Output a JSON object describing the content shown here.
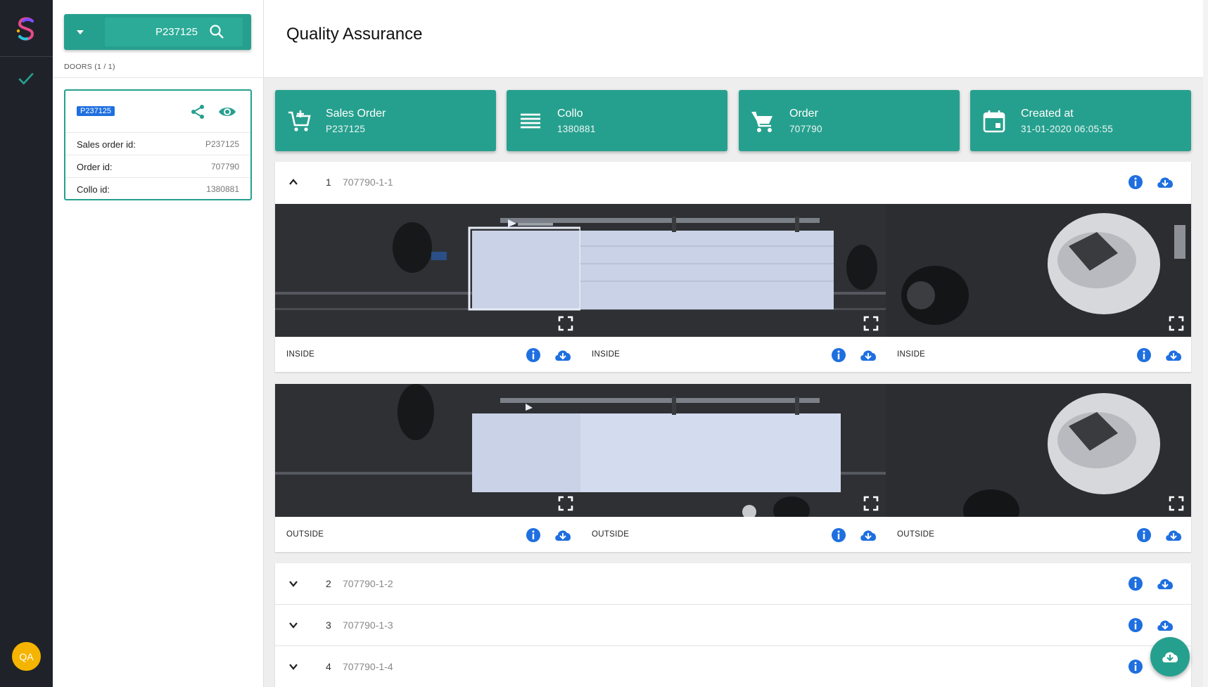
{
  "app": {
    "avatar_initials": "QA",
    "accent_color": "#26a08e",
    "tag_color": "#1e6fe0",
    "icons": [
      "logo-icon",
      "check-icon",
      "search-icon",
      "share-icon",
      "eye-icon",
      "cart-plus-icon",
      "list-icon",
      "cart-icon",
      "calendar-icon",
      "info-icon",
      "cloud-download-icon",
      "expand-icon",
      "chevron-up-icon",
      "chevron-down-icon"
    ]
  },
  "sidebar": {
    "search_value": "P237125",
    "doors_label": "DOORS (1 / 1)",
    "card": {
      "tag": "P237125",
      "rows": [
        {
          "key": "Sales order id:",
          "value": "P237125"
        },
        {
          "key": "Order id:",
          "value": "707790"
        },
        {
          "key": "Collo id:",
          "value": "1380881"
        }
      ]
    }
  },
  "header": {
    "title": "Quality Assurance"
  },
  "tiles": [
    {
      "label": "Sales Order",
      "value": "P237125"
    },
    {
      "label": "Collo",
      "value": "1380881"
    },
    {
      "label": "Order",
      "value": "707790"
    },
    {
      "label": "Created at",
      "value": "31-01-2020 06:05:55"
    }
  ],
  "rows": [
    {
      "num": "1",
      "code": "707790-1-1",
      "expanded": true
    },
    {
      "num": "2",
      "code": "707790-1-2",
      "expanded": false
    },
    {
      "num": "3",
      "code": "707790-1-3",
      "expanded": false
    },
    {
      "num": "4",
      "code": "707790-1-4",
      "expanded": false
    }
  ],
  "inside_captions": [
    "INSIDE",
    "INSIDE",
    "INSIDE"
  ],
  "outside_captions": [
    "OUTSIDE",
    "OUTSIDE",
    "OUTSIDE"
  ]
}
